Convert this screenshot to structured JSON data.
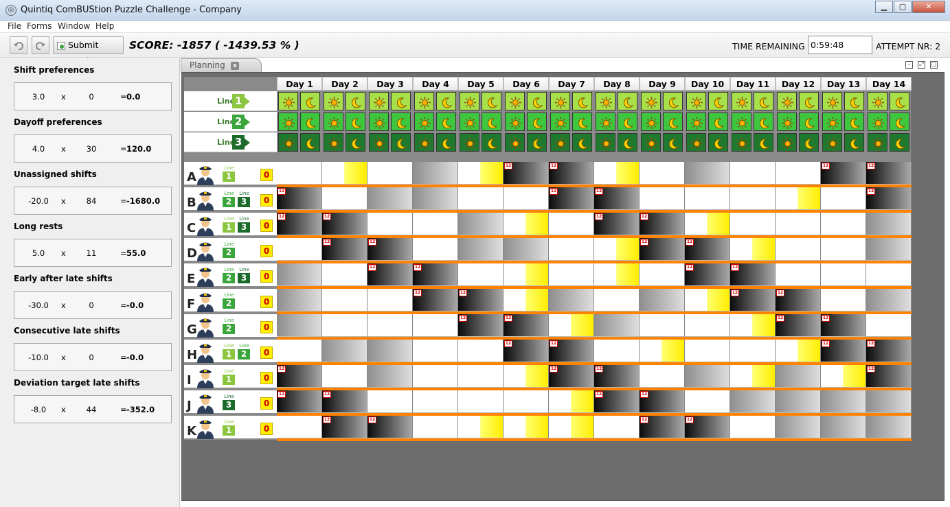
{
  "window": {
    "title": "Quintiq ComBUStion Puzzle Challenge - Company"
  },
  "menu": [
    "File",
    "Forms",
    "Window",
    "Help"
  ],
  "toolbar": {
    "submit_label": "Submit result",
    "score_text": "SCORE: -1857  ( -1439.53 % )",
    "time_label": "TIME REMAINING",
    "time_value": "0:59:48",
    "attempt_text": "ATTEMPT NR: 2"
  },
  "kpis": [
    {
      "title": "Shift preferences",
      "weight": "3.0",
      "count": "0",
      "result": "0.0"
    },
    {
      "title": "Dayoff preferences",
      "weight": "4.0",
      "count": "30",
      "result": "120.0"
    },
    {
      "title": "Unassigned shifts",
      "weight": "-20.0",
      "count": "84",
      "result": "-1680.0"
    },
    {
      "title": "Long rests",
      "weight": "5.0",
      "count": "11",
      "result": "55.0"
    },
    {
      "title": "Early after late shifts",
      "weight": "-30.0",
      "count": "0",
      "result": "-0.0"
    },
    {
      "title": "Consecutive late shifts",
      "weight": "-10.0",
      "count": "0",
      "result": "-0.0"
    },
    {
      "title": "Deviation target late shifts",
      "weight": "-8.0",
      "count": "44",
      "result": "-352.0"
    }
  ],
  "kpi_symbols": {
    "times": "x",
    "equals": "="
  },
  "tab": {
    "label": "Planning",
    "close": "x"
  },
  "days": [
    "Day 1",
    "Day 2",
    "Day 3",
    "Day 4",
    "Day 5",
    "Day 6",
    "Day 7",
    "Day 8",
    "Day 9",
    "Day 10",
    "Day 11",
    "Day 12",
    "Day 13",
    "Day 14"
  ],
  "lines": [
    {
      "word": "Line",
      "num": "1",
      "color": "#8cc63f",
      "cell": "#a8e04a"
    },
    {
      "word": "Line",
      "num": "2",
      "color": "#3aa53a",
      "cell": "#3fc63f"
    },
    {
      "word": "Line",
      "num": "3",
      "color": "#1d6b2a",
      "cell": "#1f7a2f"
    }
  ],
  "drivers": [
    {
      "letter": "A",
      "licenses": [
        "1"
      ],
      "unassigned": "0",
      "pattern": "W Y W G Y B B Y W G W W B B"
    },
    {
      "letter": "B",
      "licenses": [
        "2",
        "3"
      ],
      "unassigned": "0",
      "pattern": "B W G G W W B B W W W Y W B"
    },
    {
      "letter": "C",
      "licenses": [
        "1",
        "3"
      ],
      "unassigned": "0",
      "pattern": "B B W W G Y W B B Y W W W G"
    },
    {
      "letter": "D",
      "licenses": [
        "2"
      ],
      "unassigned": "0",
      "pattern": "W B B W G G W Y B B Y W W G"
    },
    {
      "letter": "E",
      "licenses": [
        "2",
        "3"
      ],
      "unassigned": "0",
      "pattern": "G W B B W Y W Y W B B W W W"
    },
    {
      "letter": "F",
      "licenses": [
        "2"
      ],
      "unassigned": "0",
      "pattern": "G W W B B Y G W G Y B B W G"
    },
    {
      "letter": "G",
      "licenses": [
        "2"
      ],
      "unassigned": "0",
      "pattern": "G W W W B B Y G W W Y B B W"
    },
    {
      "letter": "H",
      "licenses": [
        "1",
        "2"
      ],
      "unassigned": "0",
      "pattern": "W G G W W B B W Y W W Y B B"
    },
    {
      "letter": "I",
      "licenses": [
        "1"
      ],
      "unassigned": "0",
      "pattern": "B W G W W Y B B W G Y G Y B"
    },
    {
      "letter": "J",
      "licenses": [
        "3"
      ],
      "unassigned": "0",
      "pattern": "B B W W W W Y B B W G G G G"
    },
    {
      "letter": "K",
      "licenses": [
        "1"
      ],
      "unassigned": "0",
      "pattern": "W B B W Y Y Y W B B W G G G"
    }
  ],
  "badge_label": "12"
}
